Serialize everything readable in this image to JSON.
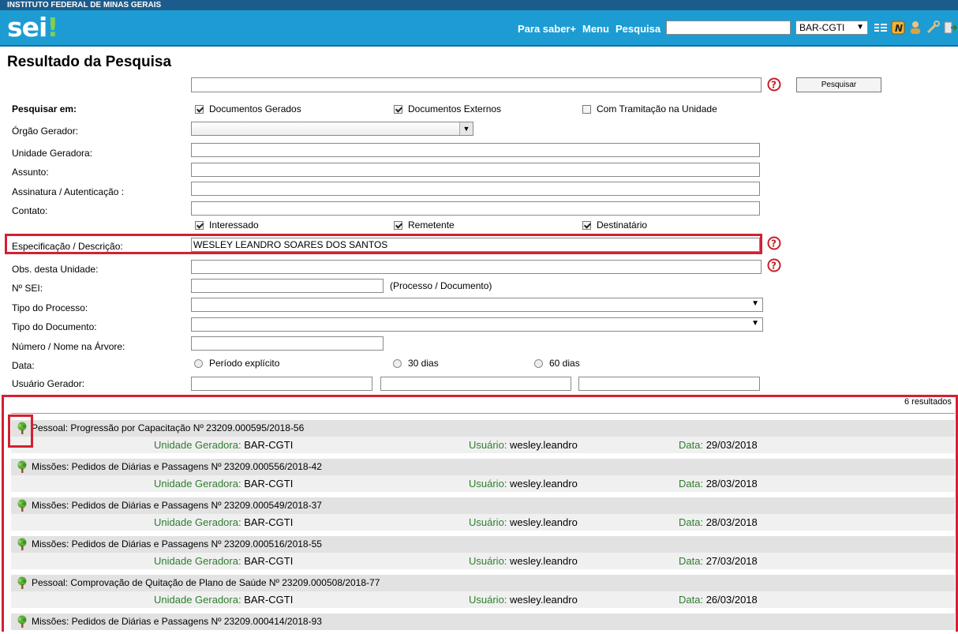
{
  "header": {
    "institution": "INSTITUTO FEDERAL DE MINAS GERAIS",
    "logo_text": "sei",
    "logo_dot": "!",
    "nav_links": [
      "Para saber+",
      "Menu",
      "Pesquisa"
    ],
    "search_value": "",
    "unit_selected": "BAR-CGTI",
    "icons": [
      "list-icon",
      "notes-icon",
      "user-icon",
      "tools-icon",
      "exit-icon"
    ]
  },
  "page": {
    "title": "Resultado da Pesquisa",
    "search_button": "Pesquisar"
  },
  "form": {
    "main_query": "",
    "pesquisar_em": {
      "label": "Pesquisar em:",
      "options": [
        {
          "label": "Documentos Gerados",
          "checked": true
        },
        {
          "label": "Documentos Externos",
          "checked": true
        },
        {
          "label": "Com Tramitação na Unidade",
          "checked": false
        }
      ]
    },
    "orgao_gerador": {
      "label": "Órgão Gerador:",
      "value": ""
    },
    "unidade_geradora": {
      "label": "Unidade Geradora:",
      "value": ""
    },
    "assunto": {
      "label": "Assunto:",
      "value": ""
    },
    "assinatura": {
      "label": "Assinatura / Autenticação :",
      "value": ""
    },
    "contato": {
      "label": "Contato:",
      "value": "",
      "options": [
        {
          "label": "Interessado",
          "checked": true
        },
        {
          "label": "Remetente",
          "checked": true
        },
        {
          "label": "Destinatário",
          "checked": true
        }
      ]
    },
    "especificacao": {
      "label": "Especificação / Descrição:",
      "value": "WESLEY LEANDRO SOARES DOS SANTOS"
    },
    "obs": {
      "label": "Obs. desta Unidade:",
      "value": ""
    },
    "numero_sei": {
      "label": "Nº SEI:",
      "value": "",
      "hint": "(Processo / Documento)"
    },
    "tipo_processo": {
      "label": "Tipo do Processo:",
      "value": ""
    },
    "tipo_documento": {
      "label": "Tipo do Documento:",
      "value": ""
    },
    "numero_arvore": {
      "label": "Número / Nome na Árvore:",
      "value": ""
    },
    "data": {
      "label": "Data:",
      "options": [
        "Período explícito",
        "30 dias",
        "60 dias"
      ]
    },
    "usuario_gerador": {
      "label": "Usuário Gerador:",
      "values": [
        "",
        "",
        ""
      ]
    }
  },
  "results": {
    "count_text": "6 resultados",
    "field_labels": {
      "unidade": "Unidade Geradora:",
      "usuario": "Usuário:",
      "data": "Data:"
    },
    "items": [
      {
        "title": "Pessoal: Progressão por Capacitação Nº 23209.000595/2018-56",
        "unidade": "BAR-CGTI",
        "usuario": "wesley.leandro",
        "data": "29/03/2018"
      },
      {
        "title": "Missões: Pedidos de Diárias e Passagens Nº 23209.000556/2018-42",
        "unidade": "BAR-CGTI",
        "usuario": "wesley.leandro",
        "data": "28/03/2018"
      },
      {
        "title": "Missões: Pedidos de Diárias e Passagens Nº 23209.000549/2018-37",
        "unidade": "BAR-CGTI",
        "usuario": "wesley.leandro",
        "data": "28/03/2018"
      },
      {
        "title": "Missões: Pedidos de Diárias e Passagens Nº 23209.000516/2018-55",
        "unidade": "BAR-CGTI",
        "usuario": "wesley.leandro",
        "data": "27/03/2018"
      },
      {
        "title": "Pessoal: Comprovação de Quitação de Plano de Saúde Nº 23209.000508/2018-77",
        "unidade": "BAR-CGTI",
        "usuario": "wesley.leandro",
        "data": "26/03/2018"
      },
      {
        "title": "Missões: Pedidos de Diárias e Passagens Nº 23209.000414/2018-93"
      }
    ]
  },
  "colors": {
    "header_blue": "#1d9cd4",
    "header_strip": "#1b5c8c",
    "label_green": "#2e7d2e",
    "highlight_red": "#d42030",
    "help_red": "#c8202a"
  }
}
